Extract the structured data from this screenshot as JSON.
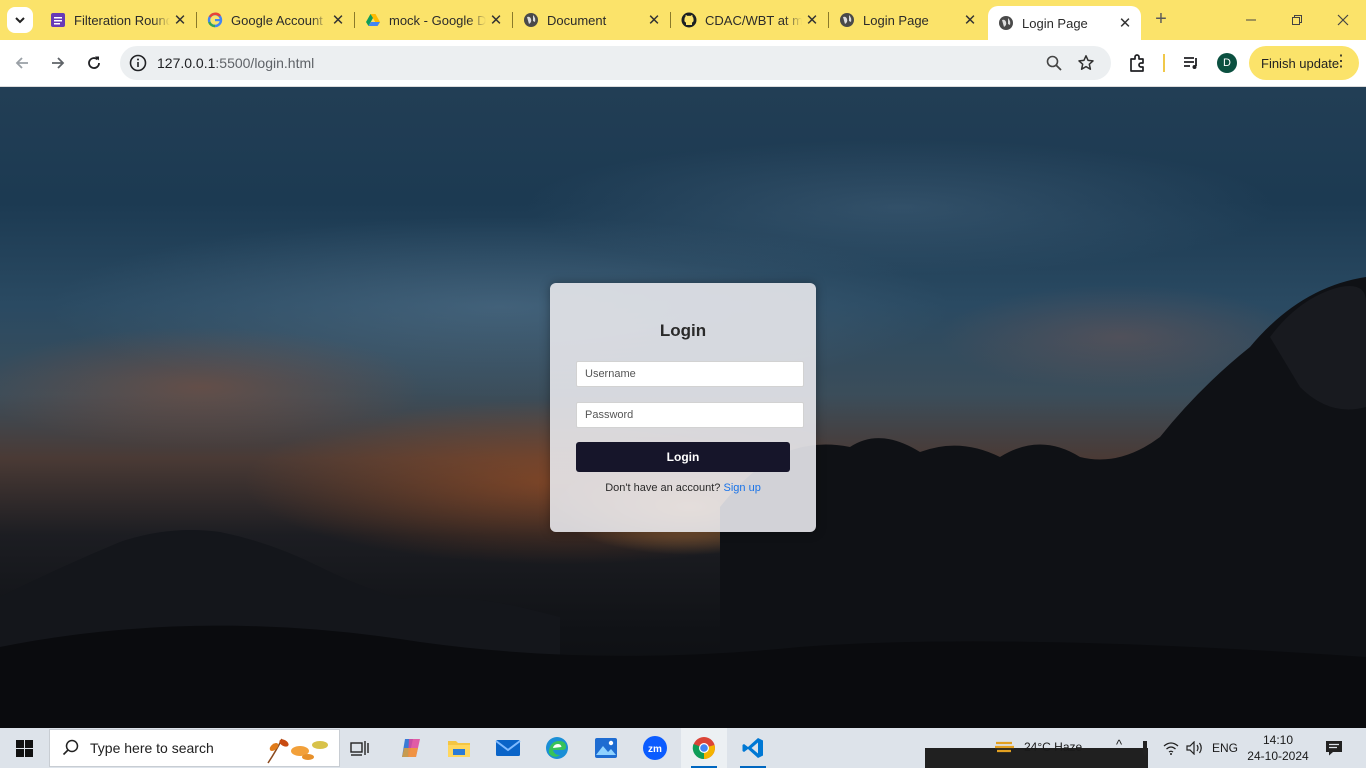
{
  "browser": {
    "tabs": [
      {
        "title": "Filteration Round",
        "icon": "forms-icon"
      },
      {
        "title": "Google Account",
        "icon": "google-icon"
      },
      {
        "title": "mock - Google Drive",
        "icon": "drive-icon"
      },
      {
        "title": "Document",
        "icon": "globe-icon"
      },
      {
        "title": "CDAC/WBT at main",
        "icon": "github-icon"
      },
      {
        "title": "Login Page",
        "icon": "globe-icon"
      },
      {
        "title": "Login Page",
        "icon": "globe-icon",
        "active": true
      }
    ],
    "url_host": "127.0.0.1",
    "url_path": ":5500/login.html",
    "profile_initial": "D",
    "update_label": "Finish update"
  },
  "page": {
    "login_title": "Login",
    "username_placeholder": "Username",
    "password_placeholder": "Password",
    "login_button": "Login",
    "signup_prompt": "Don't have an account?",
    "signup_link": "Sign up"
  },
  "taskbar": {
    "search_placeholder": "Type here to search",
    "weather": "24°C  Haze",
    "language": "ENG",
    "time": "14:10",
    "date": "24-10-2024"
  },
  "colors": {
    "tabstrip": "#fbe36a",
    "login_button": "#16152a",
    "link": "#1a73e8"
  }
}
